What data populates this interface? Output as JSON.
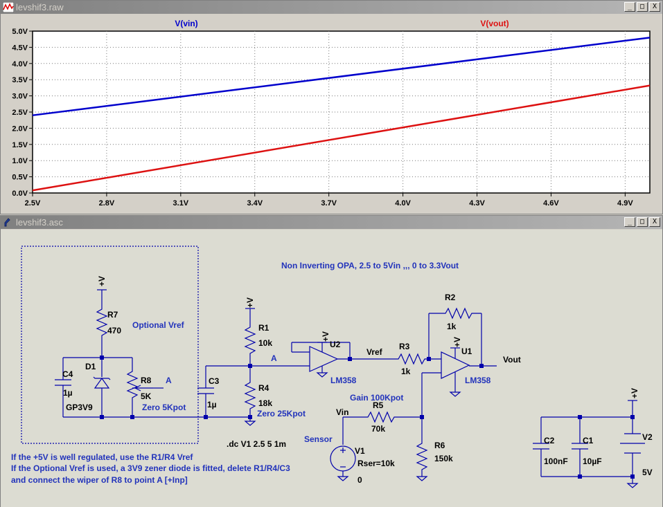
{
  "plot_window": {
    "title": "levshif3.raw",
    "buttons": [
      "_",
      "□",
      "X"
    ]
  },
  "chart_data": {
    "type": "line",
    "x": [
      2.5,
      5.0
    ],
    "series": [
      {
        "name": "V(vin)",
        "values": [
          2.4,
          4.8
        ],
        "color": "#0000cc"
      },
      {
        "name": "V(vout)",
        "values": [
          0.08,
          3.32
        ],
        "color": "#dd1111"
      }
    ],
    "xlim": [
      2.5,
      5.0
    ],
    "ylim": [
      0.0,
      5.0
    ],
    "x_ticks": [
      2.5,
      2.8,
      3.1,
      3.4,
      3.7,
      4.0,
      4.3,
      4.6,
      4.9
    ],
    "x_tick_labels": [
      "2.5V",
      "2.8V",
      "3.1V",
      "3.4V",
      "3.7V",
      "4.0V",
      "4.3V",
      "4.6V",
      "4.9V"
    ],
    "y_ticks": [
      0,
      0.5,
      1,
      1.5,
      2,
      2.5,
      3,
      3.5,
      4,
      4.5,
      5
    ],
    "y_tick_labels": [
      "0.0V",
      "0.5V",
      "1.0V",
      "1.5V",
      "2.0V",
      "2.5V",
      "3.0V",
      "3.5V",
      "4.0V",
      "4.5V",
      "5.0V"
    ],
    "grid": true
  },
  "schematic_window": {
    "title": "levshif3.asc",
    "buttons": [
      "_",
      "□",
      "X"
    ]
  },
  "schematic": {
    "title_note": "Non Inverting OPA, 2.5 to 5Vin ,,, 0 to 3.3Vout",
    "optional_vref_label": "Optional Vref",
    "notes": [
      "If the +5V is well regulated, use the R1/R4 Vref",
      "If the Optional Vref is used, a 3V9 zener diode is fitted, delete R1/R4/C3",
      "and connect the wiper of R8 to point A [+Inp]"
    ],
    "directive": ".dc V1 2.5 5 1m",
    "supply": "+V",
    "components": {
      "R7": {
        "name": "R7",
        "value": "470"
      },
      "D1": {
        "name": "D1",
        "value": "GP3V9"
      },
      "C4": {
        "name": "C4",
        "value": "1µ"
      },
      "R8": {
        "name": "R8",
        "value": "5K",
        "note": "Zero 5Kpot",
        "wiper": "A"
      },
      "R1": {
        "name": "R1",
        "value": "10k"
      },
      "R4": {
        "name": "R4",
        "value": "18k",
        "note": "Zero 25Kpot"
      },
      "C3": {
        "name": "C3",
        "value": "1µ"
      },
      "U2": {
        "name": "U2",
        "value": "LM358"
      },
      "R3": {
        "name": "R3",
        "value": "1k"
      },
      "R2": {
        "name": "R2",
        "value": "1k"
      },
      "U1": {
        "name": "U1",
        "value": "LM358"
      },
      "R5": {
        "name": "R5",
        "value": "70k",
        "note": "Gain 100Kpot"
      },
      "R6": {
        "name": "R6",
        "value": "150k"
      },
      "V1": {
        "name": "V1",
        "value": "Rser=10k",
        "dc": "0",
        "note": "Sensor"
      },
      "C2": {
        "name": "C2",
        "value": "100nF"
      },
      "C1": {
        "name": "C1",
        "value": "10µF"
      },
      "V2": {
        "name": "V2",
        "value": "5V"
      }
    },
    "nets": {
      "a": "A",
      "vref": "Vref",
      "vout": "Vout",
      "vin": "Vin"
    }
  }
}
